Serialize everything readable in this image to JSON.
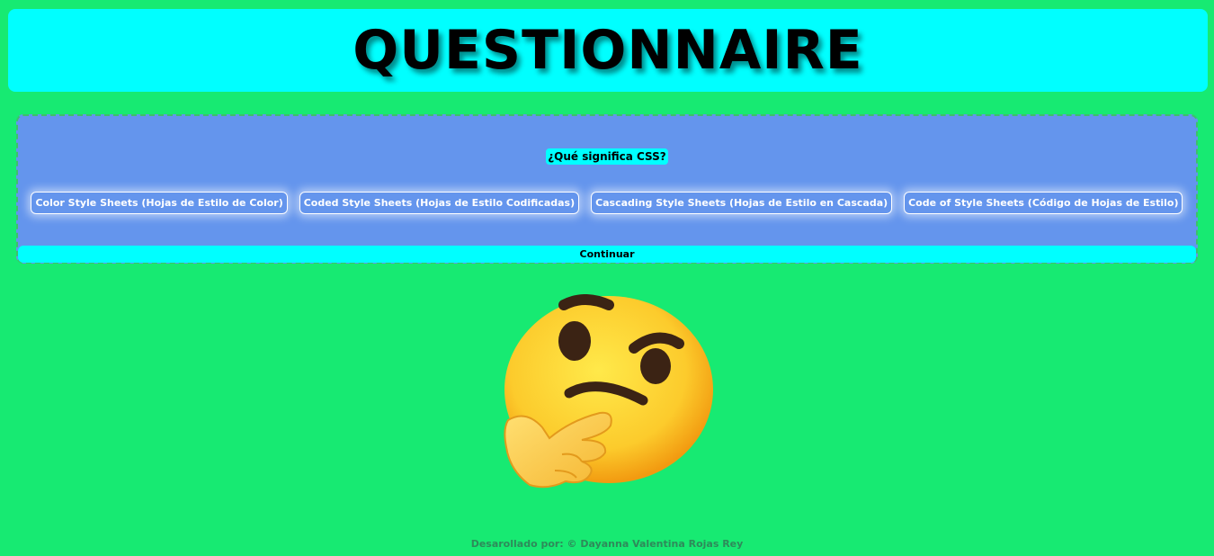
{
  "header": {
    "title": "QUESTIONNAIRE"
  },
  "quiz": {
    "question": "¿Qué significa CSS?",
    "options": [
      "Color Style Sheets (Hojas de Estilo de Color)",
      "Coded Style Sheets (Hojas de Estilo Codificadas)",
      "Cascading Style Sheets (Hojas de Estilo en Cascada)",
      "Code of Style Sheets (Código de Hojas de Estilo)"
    ],
    "continue_label": "Continuar"
  },
  "illustration": {
    "icon": "thinking-face-emoji"
  },
  "footer": {
    "credit": "Desarollado por: © Dayanna Valentina Rojas Rey"
  },
  "colors": {
    "page_background": "#17ea72",
    "header_background": "#00ffff",
    "card_background": "#6495ed",
    "accent": "#00ffff"
  }
}
